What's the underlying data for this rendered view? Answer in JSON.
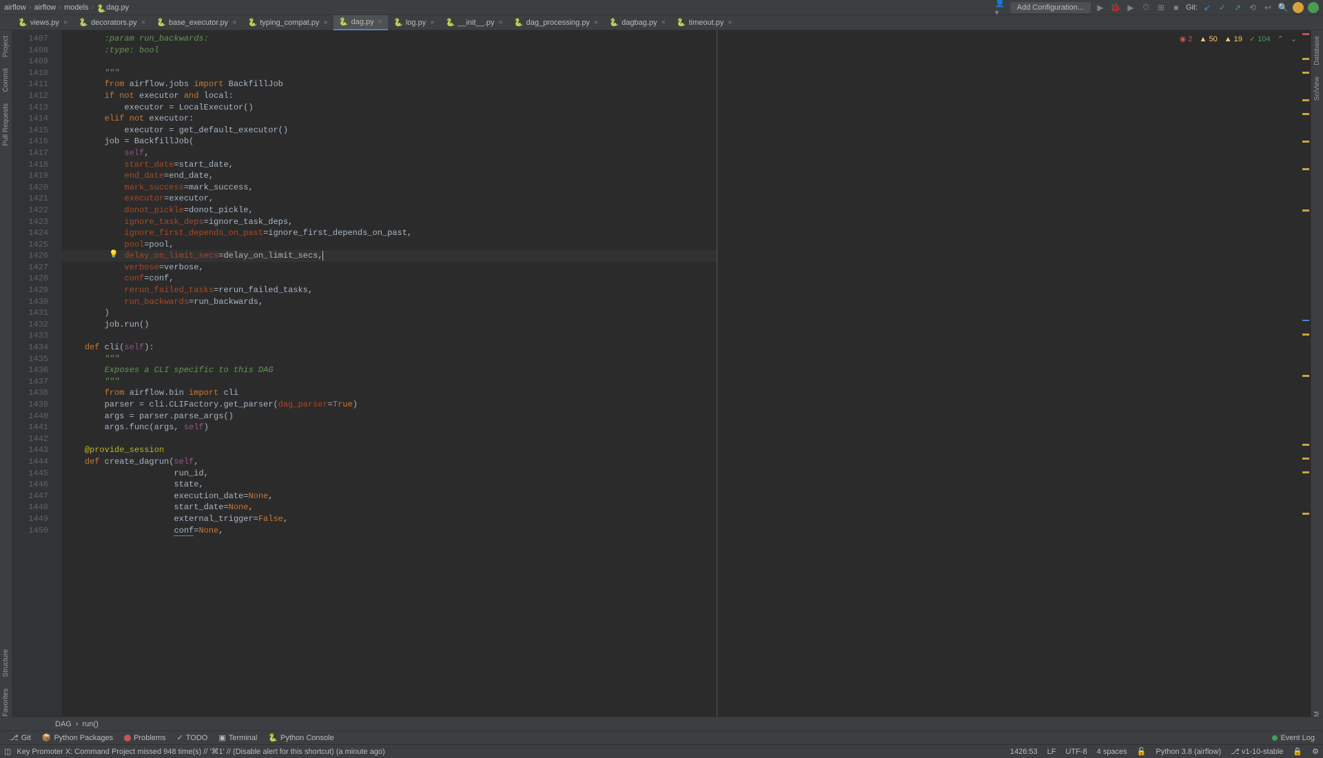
{
  "breadcrumb": {
    "p1": "airflow",
    "p2": "airflow",
    "p3": "models",
    "p4": "dag.py"
  },
  "config_btn": "Add Configuration...",
  "git_label": "Git:",
  "tabs": [
    {
      "label": "views.py"
    },
    {
      "label": "decorators.py"
    },
    {
      "label": "base_executor.py"
    },
    {
      "label": "typing_compat.py"
    },
    {
      "label": "dag.py"
    },
    {
      "label": "log.py"
    },
    {
      "label": "__init__.py"
    },
    {
      "label": "dag_processing.py"
    },
    {
      "label": "dagbag.py"
    },
    {
      "label": "timeout.py"
    }
  ],
  "left_bar": [
    "Project",
    "Commit",
    "Pull Requests"
  ],
  "right_bar": [
    "Database",
    "SciView",
    "M"
  ],
  "left_bar_bottom": [
    "Structure",
    "Favorites"
  ],
  "inspections": {
    "errors": "2",
    "warnings": "50",
    "weak": "19",
    "typos": "104"
  },
  "line_start": 1407,
  "line_end": 1450,
  "current_line": 1426,
  "bc_bot": {
    "dag": "DAG",
    "run": "run()"
  },
  "bottom_tabs": {
    "git": "Git",
    "pypkg": "Python Packages",
    "problems": "Problems",
    "todo": "TODO",
    "terminal": "Terminal",
    "pyconsole": "Python Console",
    "eventlog": "Event Log"
  },
  "status": {
    "msg": "Key Promoter X: Command Project missed 948 time(s) // '⌘1' // (Disable alert for this shortcut) (a minute ago)",
    "pos": "1426:53",
    "le": "LF",
    "enc": "UTF-8",
    "indent": "4 spaces",
    "interp": "Python 3.8 (airflow)",
    "branch": "v1-10-stable"
  },
  "code": [
    [
      {
        "c": "doc",
        "t": "        :param run_backwards:"
      }
    ],
    [
      {
        "c": "doc",
        "t": "        :type: bool"
      }
    ],
    [],
    [
      {
        "c": "doc",
        "t": "        \"\"\""
      }
    ],
    [
      {
        "c": "",
        "t": "        "
      },
      {
        "c": "kw",
        "t": "from"
      },
      {
        "c": "",
        "t": " airflow.jobs "
      },
      {
        "c": "kw",
        "t": "import"
      },
      {
        "c": "",
        "t": " BackfillJob"
      }
    ],
    [
      {
        "c": "",
        "t": "        "
      },
      {
        "c": "kw",
        "t": "if"
      },
      {
        "c": "",
        "t": " "
      },
      {
        "c": "kw",
        "t": "not"
      },
      {
        "c": "",
        "t": " executor "
      },
      {
        "c": "kw",
        "t": "and"
      },
      {
        "c": "",
        "t": " local:"
      }
    ],
    [
      {
        "c": "",
        "t": "            executor = LocalExecutor()"
      }
    ],
    [
      {
        "c": "",
        "t": "        "
      },
      {
        "c": "kw",
        "t": "elif"
      },
      {
        "c": "",
        "t": " "
      },
      {
        "c": "kw",
        "t": "not"
      },
      {
        "c": "",
        "t": " executor:"
      }
    ],
    [
      {
        "c": "",
        "t": "            executor = get_default_executor()"
      }
    ],
    [
      {
        "c": "",
        "t": "        job = BackfillJob("
      }
    ],
    [
      {
        "c": "",
        "t": "            "
      },
      {
        "c": "self",
        "t": "self"
      },
      {
        "c": "",
        "t": ","
      }
    ],
    [
      {
        "c": "",
        "t": "            "
      },
      {
        "c": "param",
        "t": "start_date"
      },
      {
        "c": "",
        "t": "=start_date,"
      }
    ],
    [
      {
        "c": "",
        "t": "            "
      },
      {
        "c": "param",
        "t": "end_date"
      },
      {
        "c": "",
        "t": "=end_date,"
      }
    ],
    [
      {
        "c": "",
        "t": "            "
      },
      {
        "c": "param",
        "t": "mark_success"
      },
      {
        "c": "",
        "t": "=mark_success,"
      }
    ],
    [
      {
        "c": "",
        "t": "            "
      },
      {
        "c": "param",
        "t": "executor"
      },
      {
        "c": "",
        "t": "=executor,"
      }
    ],
    [
      {
        "c": "",
        "t": "            "
      },
      {
        "c": "param",
        "t": "donot_pickle"
      },
      {
        "c": "",
        "t": "=donot_pickle,"
      }
    ],
    [
      {
        "c": "",
        "t": "            "
      },
      {
        "c": "param",
        "t": "ignore_task_deps"
      },
      {
        "c": "",
        "t": "=ignore_task_deps,"
      }
    ],
    [
      {
        "c": "",
        "t": "            "
      },
      {
        "c": "param",
        "t": "ignore_first_depends_on_past"
      },
      {
        "c": "",
        "t": "=ignore_first_depends_on_past,"
      }
    ],
    [
      {
        "c": "",
        "t": "            "
      },
      {
        "c": "param",
        "t": "pool"
      },
      {
        "c": "",
        "t": "=pool,"
      }
    ],
    [
      {
        "c": "",
        "t": "            "
      },
      {
        "c": "param",
        "t": "delay_on_limit_secs"
      },
      {
        "c": "",
        "t": "=delay_on_limit_secs,"
      }
    ],
    [
      {
        "c": "",
        "t": "            "
      },
      {
        "c": "param",
        "t": "verbose"
      },
      {
        "c": "",
        "t": "=verbose,"
      }
    ],
    [
      {
        "c": "",
        "t": "            "
      },
      {
        "c": "param",
        "t": "conf"
      },
      {
        "c": "",
        "t": "=conf,"
      }
    ],
    [
      {
        "c": "",
        "t": "            "
      },
      {
        "c": "param",
        "t": "rerun_failed_tasks"
      },
      {
        "c": "",
        "t": "=rerun_failed_tasks,"
      }
    ],
    [
      {
        "c": "",
        "t": "            "
      },
      {
        "c": "param",
        "t": "run_backwards"
      },
      {
        "c": "",
        "t": "=run_backwards,"
      }
    ],
    [
      {
        "c": "",
        "t": "        )"
      }
    ],
    [
      {
        "c": "",
        "t": "        job.run()"
      }
    ],
    [],
    [
      {
        "c": "",
        "t": "    "
      },
      {
        "c": "kw",
        "t": "def"
      },
      {
        "c": "",
        "t": " cli("
      },
      {
        "c": "self",
        "t": "self"
      },
      {
        "c": "",
        "t": "):"
      }
    ],
    [
      {
        "c": "doc",
        "t": "        \"\"\""
      }
    ],
    [
      {
        "c": "doc",
        "t": "        Exposes a CLI specific to this DAG"
      }
    ],
    [
      {
        "c": "doc",
        "t": "        \"\"\""
      }
    ],
    [
      {
        "c": "",
        "t": "        "
      },
      {
        "c": "kw",
        "t": "from"
      },
      {
        "c": "",
        "t": " airflow.bin "
      },
      {
        "c": "kw",
        "t": "import"
      },
      {
        "c": "",
        "t": " cli"
      }
    ],
    [
      {
        "c": "",
        "t": "        parser = cli.CLIFactory.get_parser("
      },
      {
        "c": "param",
        "t": "dag_parser"
      },
      {
        "c": "",
        "t": "="
      },
      {
        "c": "kw",
        "t": "True"
      },
      {
        "c": "",
        "t": ")"
      }
    ],
    [
      {
        "c": "",
        "t": "        args = parser.parse_args()"
      }
    ],
    [
      {
        "c": "",
        "t": "        args.func(args, "
      },
      {
        "c": "self",
        "t": "self"
      },
      {
        "c": "",
        "t": ")"
      }
    ],
    [],
    [
      {
        "c": "",
        "t": "    "
      },
      {
        "c": "dec",
        "t": "@provide_session"
      }
    ],
    [
      {
        "c": "",
        "t": "    "
      },
      {
        "c": "kw",
        "t": "def"
      },
      {
        "c": "",
        "t": " create_dagrun("
      },
      {
        "c": "self",
        "t": "self"
      },
      {
        "c": "",
        "t": ","
      }
    ],
    [
      {
        "c": "",
        "t": "                      run_id,"
      }
    ],
    [
      {
        "c": "",
        "t": "                      state,"
      }
    ],
    [
      {
        "c": "",
        "t": "                      execution_date="
      },
      {
        "c": "kw",
        "t": "None"
      },
      {
        "c": "",
        "t": ","
      }
    ],
    [
      {
        "c": "",
        "t": "                      start_date="
      },
      {
        "c": "kw",
        "t": "None"
      },
      {
        "c": "",
        "t": ","
      }
    ],
    [
      {
        "c": "",
        "t": "                      external_trigger="
      },
      {
        "c": "kw",
        "t": "False"
      },
      {
        "c": "",
        "t": ","
      }
    ],
    [
      {
        "c": "",
        "t": "                      "
      },
      {
        "c": "underline",
        "t": "conf"
      },
      {
        "c": "",
        "t": "="
      },
      {
        "c": "kw",
        "t": "None"
      },
      {
        "c": "",
        "t": ","
      }
    ]
  ]
}
